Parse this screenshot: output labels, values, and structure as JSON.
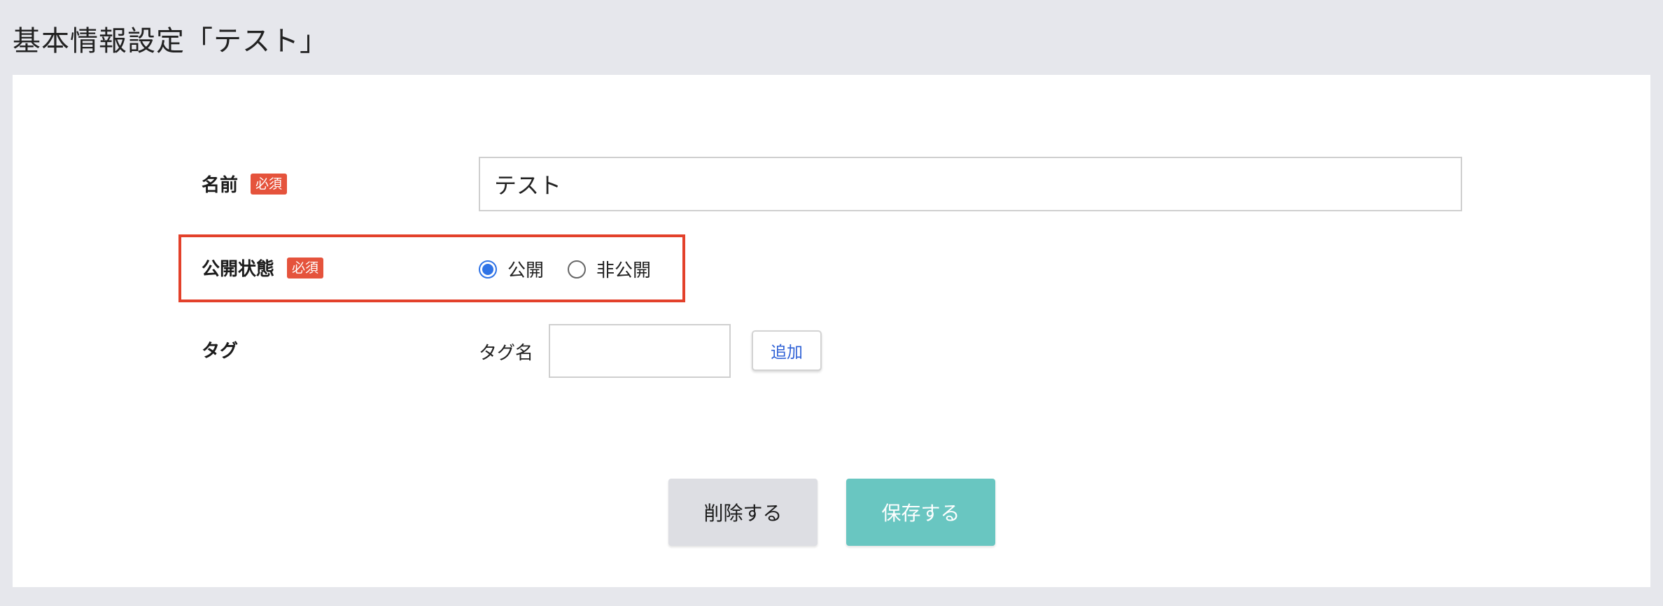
{
  "page": {
    "title": "基本情報設定「テスト」"
  },
  "form": {
    "name": {
      "label": "名前",
      "required_badge": "必須",
      "value": "テスト"
    },
    "visibility": {
      "label": "公開状態",
      "required_badge": "必須",
      "options": [
        {
          "label": "公開",
          "checked": true
        },
        {
          "label": "非公開",
          "checked": false
        }
      ]
    },
    "tag": {
      "label": "タグ",
      "name_label": "タグ名",
      "value": "",
      "add_label": "追加"
    }
  },
  "actions": {
    "delete_label": "削除する",
    "save_label": "保存する"
  },
  "colors": {
    "background": "#e6e7ec",
    "required_badge": "#e5533c",
    "highlight_border": "#e3412b",
    "radio_accent": "#2f73e6",
    "link_text": "#2f61d6",
    "delete_button": "#dddee3",
    "save_button": "#69c6c1"
  }
}
